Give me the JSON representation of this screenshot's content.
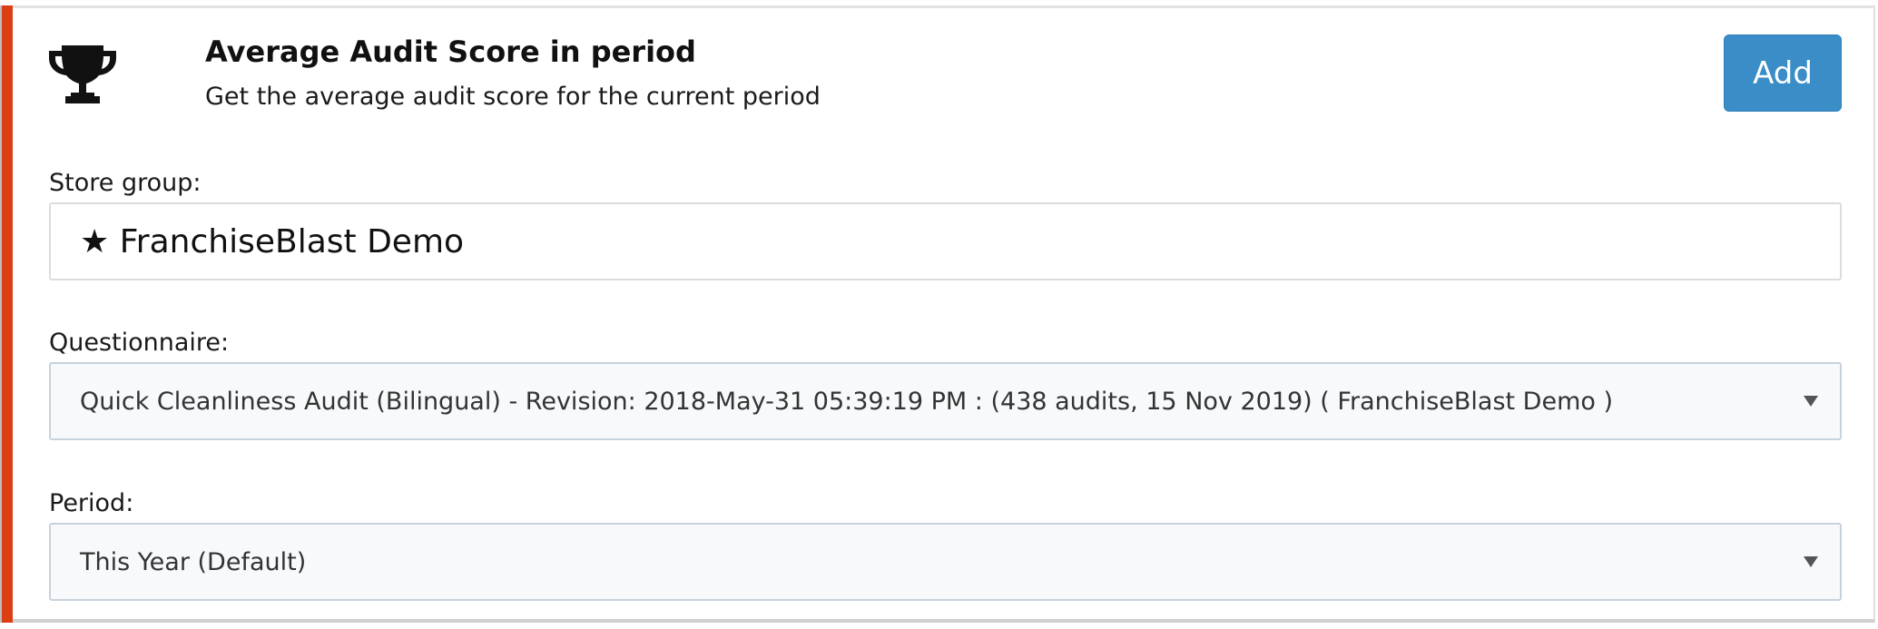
{
  "widget": {
    "icon": "trophy-icon",
    "title": "Average Audit Score in period",
    "description": "Get the average audit score for the current period",
    "add_label": "Add",
    "accent_color": "#dd3d12",
    "button_color": "#3a8dc7"
  },
  "store_group": {
    "label": "Store group:",
    "value": "★ FranchiseBlast Demo"
  },
  "questionnaire": {
    "label": "Questionnaire:",
    "selected": "Quick Cleanliness Audit (Bilingual) - Revision: 2018-May-31 05:39:19 PM : (438 audits, 15 Nov 2019) ( FranchiseBlast Demo )"
  },
  "period": {
    "label": "Period:",
    "selected": "This Year (Default)"
  }
}
